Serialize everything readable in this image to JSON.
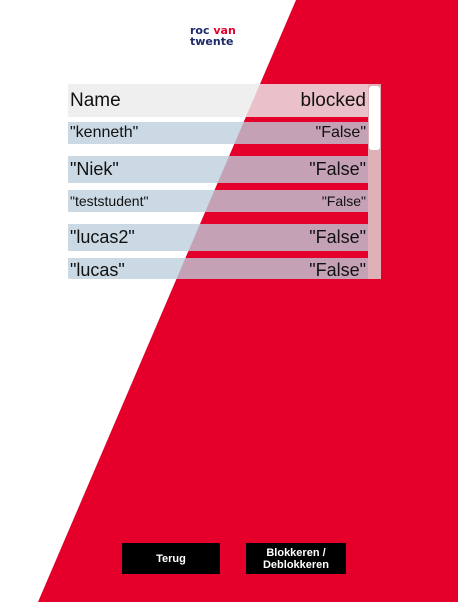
{
  "logo": {
    "line1_a": "roc",
    "line1_b": "van",
    "line2": "twente"
  },
  "table": {
    "header": {
      "left": "Name",
      "right": "blocked"
    },
    "rows": [
      {
        "name": "\"kenneth\"",
        "blocked": "\"False\""
      },
      {
        "name": "\"Niek\"",
        "blocked": "\"False\""
      },
      {
        "name": "\"teststudent\"",
        "blocked": "\"False\""
      },
      {
        "name": "\"lucas2\"",
        "blocked": "\"False\""
      },
      {
        "name": "\"lucas\"",
        "blocked": "\"False\""
      }
    ]
  },
  "buttons": {
    "back": "Terug",
    "block_line1": "Blokkeren /",
    "block_line2": "Deblokkeren"
  },
  "colors": {
    "accent": "#e4002b",
    "navy": "#1d2b6b"
  }
}
